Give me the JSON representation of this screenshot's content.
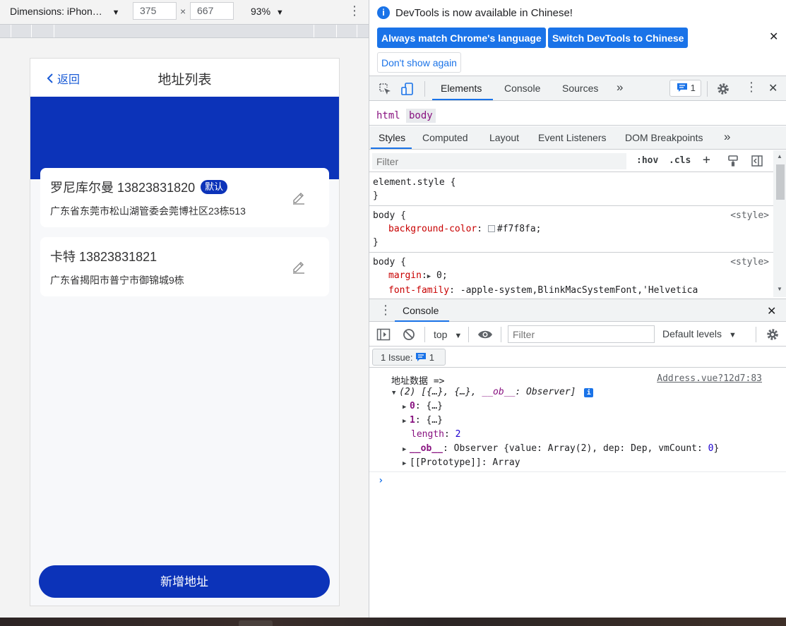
{
  "device_toolbar": {
    "dimensions_label": "Dimensions: iPhon…",
    "width": "375",
    "height": "667",
    "times": "×",
    "zoom": "93%"
  },
  "phone": {
    "nav": {
      "back_label": "返回",
      "title": "地址列表"
    },
    "addresses": [
      {
        "name_phone": "罗尼库尔曼 13823831820",
        "badge": "默认",
        "address": "广东省东莞市松山湖管委会莞博社区23栋513"
      },
      {
        "name_phone": "卡特 13823831821",
        "badge": "",
        "address": "广东省揭阳市普宁市御锦城9栋"
      }
    ],
    "add_button": "新增地址",
    "colors": {
      "brand": "#0c33b9",
      "background": "#f7f8fa"
    }
  },
  "devtools": {
    "infobar": {
      "message": "DevTools is now available in Chinese!",
      "btn_match": "Always match Chrome's language",
      "btn_switch": "Switch DevTools to Chinese",
      "btn_dont_show": "Don't show again"
    },
    "main_tabs": [
      "Elements",
      "Console",
      "Sources"
    ],
    "more_tabs": "»",
    "issue_count": "1",
    "breadcrumb": [
      "html",
      "body"
    ],
    "sub_tabs": [
      "Styles",
      "Computed",
      "Layout",
      "Event Listeners",
      "DOM Breakpoints"
    ],
    "styles_filter_placeholder": "Filter",
    "hov": ":hov",
    "cls": ".cls",
    "rules": {
      "element_style": "element.style {",
      "close_brace": "}",
      "body_sel": "body {",
      "origin": "<style>",
      "bg_name": "background-color",
      "bg_value": "#f7f8fa;",
      "margin_name": "margin",
      "margin_value": "0;",
      "font_name": "font-family",
      "font_value": "-apple-system,BlinkMacSystemFont,'Helvetica"
    },
    "drawer_tab": "Console",
    "console_toolbar": {
      "context": "top",
      "filter_placeholder": "Filter",
      "levels": "Default levels"
    },
    "issues_label": "1 Issue:",
    "issues_count": "1",
    "console_log": {
      "message": "地址数据 =>",
      "source": "Address.vue?12d7:83",
      "summary_open": "(2) [{…}, {…}, ",
      "summary_ob": "__ob__",
      "summary_close": ": Observer]",
      "item0_key": "0",
      "item0_val": "{…}",
      "item1_key": "1",
      "item1_val": "{…}",
      "length_key": "length",
      "length_val": "2",
      "ob_key": "__ob__",
      "ob_val_a": "Observer {value: Array(2), dep: Dep, vmCount: ",
      "ob_val_num": "0",
      "ob_val_b": "}",
      "proto": "[[Prototype]]: Array"
    },
    "prompt": "›"
  }
}
